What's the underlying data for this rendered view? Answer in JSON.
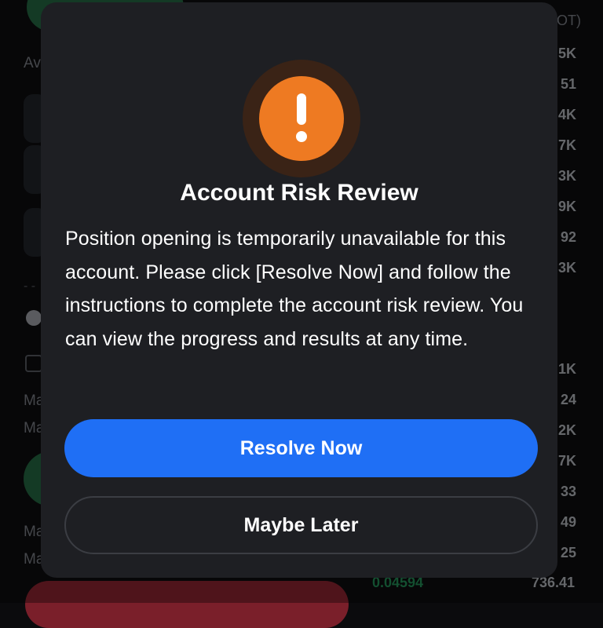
{
  "background": {
    "left_labels": [
      "Av",
      "Ma",
      "Ma",
      "Ma",
      "Ma"
    ],
    "orderbook_header": "OT)",
    "orderbook_quantities": [
      "5K",
      "51",
      "4K",
      "7K",
      "3K",
      "9K",
      "92",
      "3K",
      "1K",
      "24",
      "2K",
      "7K",
      "33",
      "49",
      "25"
    ],
    "last_row": {
      "price": "0.04594",
      "quantity": "736.41"
    }
  },
  "modal": {
    "icon": "exclamation-alert-icon",
    "title": "Account Risk Review",
    "body": "Position opening is temporarily unavailable for this account. Please click [Resolve Now] and follow the instructions to complete the account risk review. You can view the progress and results at any time.",
    "primary_button": "Resolve Now",
    "secondary_button": "Maybe Later"
  },
  "colors": {
    "accent_blue": "#1f6ff5",
    "alert_orange": "#ee7a22",
    "modal_bg": "#1e1f23"
  }
}
